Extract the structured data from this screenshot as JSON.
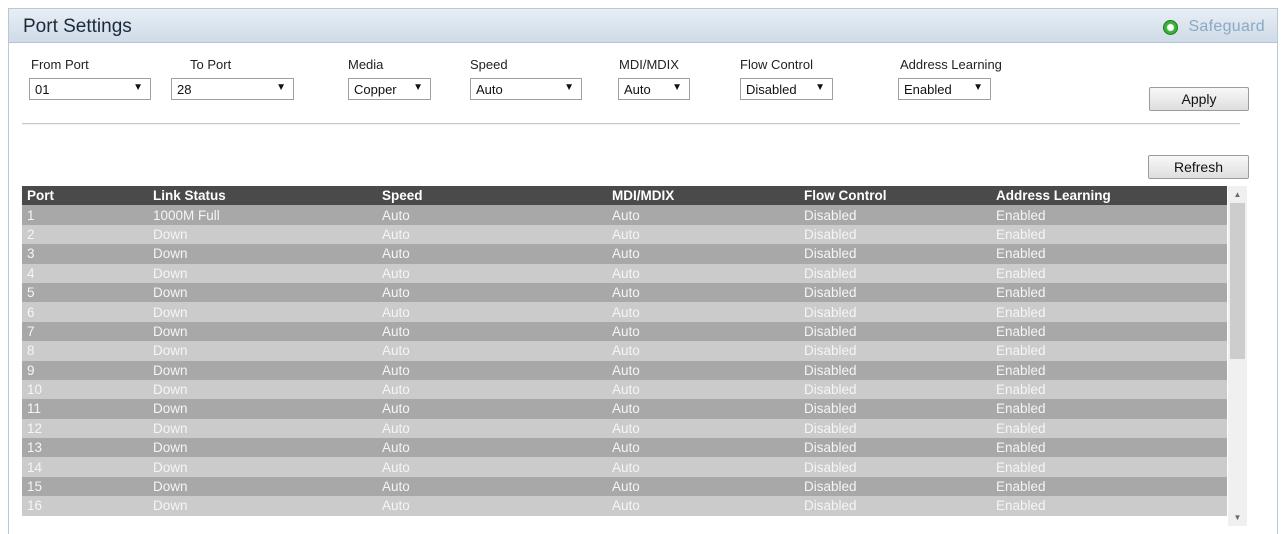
{
  "header": {
    "title": "Port Settings",
    "safeguard_label": "Safeguard",
    "safeguard_icon": "status-led-icon",
    "safeguard_color": "#38b238"
  },
  "form": {
    "from_port": {
      "label": "From Port",
      "value": "01"
    },
    "to_port": {
      "label": "To Port",
      "value": "28"
    },
    "media": {
      "label": "Media",
      "value": "Copper"
    },
    "speed": {
      "label": "Speed",
      "value": "Auto"
    },
    "mdi": {
      "label": "MDI/MDIX",
      "value": "Auto"
    },
    "flow_control": {
      "label": "Flow Control",
      "value": "Disabled"
    },
    "address_learning": {
      "label": "Address Learning",
      "value": "Enabled"
    },
    "dropdown_arrow": "▼",
    "apply_label": "Apply",
    "refresh_label": "Refresh"
  },
  "table": {
    "columns": [
      "Port",
      "Link Status",
      "Speed",
      "MDI/MDIX",
      "Flow Control",
      "Address Learning"
    ],
    "rows": [
      [
        "1",
        "1000M Full",
        "Auto",
        "Auto",
        "Disabled",
        "Enabled"
      ],
      [
        "2",
        "Down",
        "Auto",
        "Auto",
        "Disabled",
        "Enabled"
      ],
      [
        "3",
        "Down",
        "Auto",
        "Auto",
        "Disabled",
        "Enabled"
      ],
      [
        "4",
        "Down",
        "Auto",
        "Auto",
        "Disabled",
        "Enabled"
      ],
      [
        "5",
        "Down",
        "Auto",
        "Auto",
        "Disabled",
        "Enabled"
      ],
      [
        "6",
        "Down",
        "Auto",
        "Auto",
        "Disabled",
        "Enabled"
      ],
      [
        "7",
        "Down",
        "Auto",
        "Auto",
        "Disabled",
        "Enabled"
      ],
      [
        "8",
        "Down",
        "Auto",
        "Auto",
        "Disabled",
        "Enabled"
      ],
      [
        "9",
        "Down",
        "Auto",
        "Auto",
        "Disabled",
        "Enabled"
      ],
      [
        "10",
        "Down",
        "Auto",
        "Auto",
        "Disabled",
        "Enabled"
      ],
      [
        "11",
        "Down",
        "Auto",
        "Auto",
        "Disabled",
        "Enabled"
      ],
      [
        "12",
        "Down",
        "Auto",
        "Auto",
        "Disabled",
        "Enabled"
      ],
      [
        "13",
        "Down",
        "Auto",
        "Auto",
        "Disabled",
        "Enabled"
      ],
      [
        "14",
        "Down",
        "Auto",
        "Auto",
        "Disabled",
        "Enabled"
      ],
      [
        "15",
        "Down",
        "Auto",
        "Auto",
        "Disabled",
        "Enabled"
      ],
      [
        "16",
        "Down",
        "Auto",
        "Auto",
        "Disabled",
        "Enabled"
      ]
    ],
    "scroll_up_icon": "▲",
    "scroll_down_icon": "▼"
  }
}
